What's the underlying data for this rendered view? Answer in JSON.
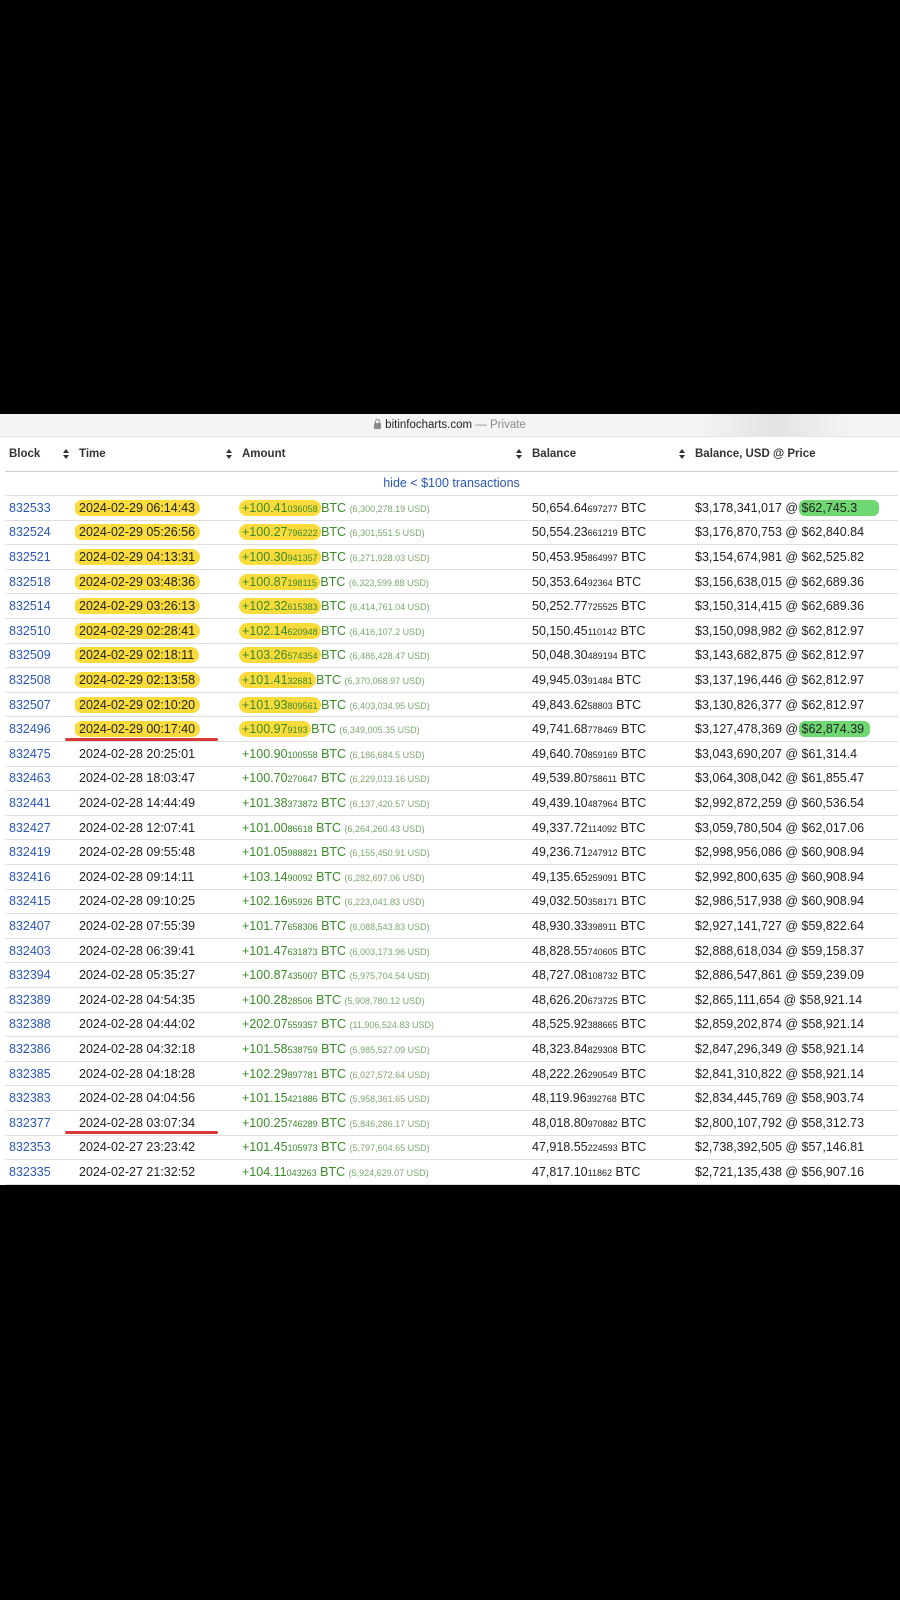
{
  "browser": {
    "domain": "bitinfocharts.com",
    "mode": "— Private"
  },
  "table": {
    "headers": {
      "block": "Block",
      "time": "Time",
      "amount": "Amount",
      "balance": "Balance",
      "balance_usd": "Balance, USD @ Price"
    },
    "filter_link": "hide < $100 transactions",
    "rows": [
      {
        "block": "832533",
        "time": "2024-02-29 06:14:43",
        "amt_main": "+100.41",
        "amt_small": "036058",
        "amt_unit": "BTC",
        "amt_usd": "(6,300,278.19 USD)",
        "bal_main": "50,654.64",
        "bal_small": "697277",
        "bal_unit": "BTC",
        "usd": "$3,178,341,017 @ $62,745.3"
      },
      {
        "block": "832524",
        "time": "2024-02-29 05:26:56",
        "amt_main": "+100.27",
        "amt_small": "796222",
        "amt_unit": "BTC",
        "amt_usd": "(6,301,551.5 USD)",
        "bal_main": "50,554.23",
        "bal_small": "661219",
        "bal_unit": "BTC",
        "usd": "$3,176,870,753 @ $62,840.84"
      },
      {
        "block": "832521",
        "time": "2024-02-29 04:13:31",
        "amt_main": "+100.30",
        "amt_small": "941357",
        "amt_unit": "BTC",
        "amt_usd": "(6,271,928.03 USD)",
        "bal_main": "50,453.95",
        "bal_small": "864997",
        "bal_unit": "BTC",
        "usd": "$3,154,674,981 @ $62,525.82"
      },
      {
        "block": "832518",
        "time": "2024-02-29 03:48:36",
        "amt_main": "+100.87",
        "amt_small": "198115",
        "amt_unit": "BTC",
        "amt_usd": "(6,323,599.88 USD)",
        "bal_main": "50,353.64",
        "bal_small": "92364",
        "bal_unit": "BTC",
        "usd": "$3,156,638,015 @ $62,689.36"
      },
      {
        "block": "832514",
        "time": "2024-02-29 03:26:13",
        "amt_main": "+102.32",
        "amt_small": "615383",
        "amt_unit": "BTC",
        "amt_usd": "(6,414,761.04 USD)",
        "bal_main": "50,252.77",
        "bal_small": "725525",
        "bal_unit": "BTC",
        "usd": "$3,150,314,415 @ $62,689.36"
      },
      {
        "block": "832510",
        "time": "2024-02-29 02:28:41",
        "amt_main": "+102.14",
        "amt_small": "620948",
        "amt_unit": "BTC",
        "amt_usd": "(6,416,107.2 USD)",
        "bal_main": "50,150.45",
        "bal_small": "110142",
        "bal_unit": "BTC",
        "usd": "$3,150,098,982 @ $62,812.97"
      },
      {
        "block": "832509",
        "time": "2024-02-29 02:18:11",
        "amt_main": "+103.26",
        "amt_small": "574354",
        "amt_unit": "BTC",
        "amt_usd": "(6,486,428.47 USD)",
        "bal_main": "50,048.30",
        "bal_small": "489194",
        "bal_unit": "BTC",
        "usd": "$3,143,682,875 @ $62,812.97"
      },
      {
        "block": "832508",
        "time": "2024-02-29 02:13:58",
        "amt_main": "+101.41",
        "amt_small": "32681",
        "amt_unit": "BTC",
        "amt_usd": "(6,370,068.97 USD)",
        "bal_main": "49,945.03",
        "bal_small": "91484",
        "bal_unit": "BTC",
        "usd": "$3,137,196,446 @ $62,812.97"
      },
      {
        "block": "832507",
        "time": "2024-02-29 02:10:20",
        "amt_main": "+101.93",
        "amt_small": "809561",
        "amt_unit": "BTC",
        "amt_usd": "(6,403,034.95 USD)",
        "bal_main": "49,843.62",
        "bal_small": "58803",
        "bal_unit": "BTC",
        "usd": "$3,130,826,377 @ $62,812.97"
      },
      {
        "block": "832496",
        "time": "2024-02-29 00:17:40",
        "amt_main": "+100.97",
        "amt_small": "9193",
        "amt_unit": "BTC",
        "amt_usd": "(6,349,005.35 USD)",
        "bal_main": "49,741.68",
        "bal_small": "778469",
        "bal_unit": "BTC",
        "usd": "$3,127,478,369 @ $62,874.39"
      },
      {
        "block": "832475",
        "time": "2024-02-28 20:25:01",
        "amt_main": "+100.90",
        "amt_small": "100558",
        "amt_unit": "BTC",
        "amt_usd": "(6,186,684.5 USD)",
        "bal_main": "49,640.70",
        "bal_small": "859169",
        "bal_unit": "BTC",
        "usd": "$3,043,690,207 @ $61,314.4"
      },
      {
        "block": "832463",
        "time": "2024-02-28 18:03:47",
        "amt_main": "+100.70",
        "amt_small": "270647",
        "amt_unit": "BTC",
        "amt_usd": "(6,229,013.16 USD)",
        "bal_main": "49,539.80",
        "bal_small": "758611",
        "bal_unit": "BTC",
        "usd": "$3,064,308,042 @ $61,855.47"
      },
      {
        "block": "832441",
        "time": "2024-02-28 14:44:49",
        "amt_main": "+101.38",
        "amt_small": "373872",
        "amt_unit": "BTC",
        "amt_usd": "(6,137,420.57 USD)",
        "bal_main": "49,439.10",
        "bal_small": "487964",
        "bal_unit": "BTC",
        "usd": "$2,992,872,259 @ $60,536.54"
      },
      {
        "block": "832427",
        "time": "2024-02-28 12:07:41",
        "amt_main": "+101.00",
        "amt_small": "86618",
        "amt_unit": "BTC",
        "amt_usd": "(6,264,260.43 USD)",
        "bal_main": "49,337.72",
        "bal_small": "114092",
        "bal_unit": "BTC",
        "usd": "$3,059,780,504 @ $62,017.06"
      },
      {
        "block": "832419",
        "time": "2024-02-28 09:55:48",
        "amt_main": "+101.05",
        "amt_small": "988821",
        "amt_unit": "BTC",
        "amt_usd": "(6,155,450.91 USD)",
        "bal_main": "49,236.71",
        "bal_small": "247912",
        "bal_unit": "BTC",
        "usd": "$2,998,956,086 @ $60,908.94"
      },
      {
        "block": "832416",
        "time": "2024-02-28 09:14:11",
        "amt_main": "+103.14",
        "amt_small": "90092",
        "amt_unit": "BTC",
        "amt_usd": "(6,282,697.06 USD)",
        "bal_main": "49,135.65",
        "bal_small": "259091",
        "bal_unit": "BTC",
        "usd": "$2,992,800,635 @ $60,908.94"
      },
      {
        "block": "832415",
        "time": "2024-02-28 09:10:25",
        "amt_main": "+102.16",
        "amt_small": "95926",
        "amt_unit": "BTC",
        "amt_usd": "(6,223,041.83 USD)",
        "bal_main": "49,032.50",
        "bal_small": "358171",
        "bal_unit": "BTC",
        "usd": "$2,986,517,938 @ $60,908.94"
      },
      {
        "block": "832407",
        "time": "2024-02-28 07:55:39",
        "amt_main": "+101.77",
        "amt_small": "658306",
        "amt_unit": "BTC",
        "amt_usd": "(6,088,543.83 USD)",
        "bal_main": "48,930.33",
        "bal_small": "398911",
        "bal_unit": "BTC",
        "usd": "$2,927,141,727 @ $59,822.64"
      },
      {
        "block": "832403",
        "time": "2024-02-28 06:39:41",
        "amt_main": "+101.47",
        "amt_small": "631873",
        "amt_unit": "BTC",
        "amt_usd": "(6,003,173.96 USD)",
        "bal_main": "48,828.55",
        "bal_small": "740605",
        "bal_unit": "BTC",
        "usd": "$2,888,618,034 @ $59,158.37"
      },
      {
        "block": "832394",
        "time": "2024-02-28 05:35:27",
        "amt_main": "+100.87",
        "amt_small": "435007",
        "amt_unit": "BTC",
        "amt_usd": "(5,975,704.54 USD)",
        "bal_main": "48,727.08",
        "bal_small": "108732",
        "bal_unit": "BTC",
        "usd": "$2,886,547,861 @ $59,239.09"
      },
      {
        "block": "832389",
        "time": "2024-02-28 04:54:35",
        "amt_main": "+100.28",
        "amt_small": "28506",
        "amt_unit": "BTC",
        "amt_usd": "(5,908,780.12 USD)",
        "bal_main": "48,626.20",
        "bal_small": "673725",
        "bal_unit": "BTC",
        "usd": "$2,865,111,654 @ $58,921.14"
      },
      {
        "block": "832388",
        "time": "2024-02-28 04:44:02",
        "amt_main": "+202.07",
        "amt_small": "559357",
        "amt_unit": "BTC",
        "amt_usd": "(11,906,524.83 USD)",
        "bal_main": "48,525.92",
        "bal_small": "388665",
        "bal_unit": "BTC",
        "usd": "$2,859,202,874 @ $58,921.14"
      },
      {
        "block": "832386",
        "time": "2024-02-28 04:32:18",
        "amt_main": "+101.58",
        "amt_small": "538759",
        "amt_unit": "BTC",
        "amt_usd": "(5,985,527.09 USD)",
        "bal_main": "48,323.84",
        "bal_small": "829308",
        "bal_unit": "BTC",
        "usd": "$2,847,296,349 @ $58,921.14"
      },
      {
        "block": "832385",
        "time": "2024-02-28 04:18:28",
        "amt_main": "+102.29",
        "amt_small": "897781",
        "amt_unit": "BTC",
        "amt_usd": "(6,027,572.64 USD)",
        "bal_main": "48,222.26",
        "bal_small": "290549",
        "bal_unit": "BTC",
        "usd": "$2,841,310,822 @ $58,921.14"
      },
      {
        "block": "832383",
        "time": "2024-02-28 04:04:56",
        "amt_main": "+101.15",
        "amt_small": "421886",
        "amt_unit": "BTC",
        "amt_usd": "(5,958,361.65 USD)",
        "bal_main": "48,119.96",
        "bal_small": "392768",
        "bal_unit": "BTC",
        "usd": "$2,834,445,769 @ $58,903.74"
      },
      {
        "block": "832377",
        "time": "2024-02-28 03:07:34",
        "amt_main": "+100.25",
        "amt_small": "746289",
        "amt_unit": "BTC",
        "amt_usd": "(5,846,286.17 USD)",
        "bal_main": "48,018.80",
        "bal_small": "970882",
        "bal_unit": "BTC",
        "usd": "$2,800,107,792 @ $58,312.73"
      },
      {
        "block": "832353",
        "time": "2024-02-27 23:23:42",
        "amt_main": "+101.45",
        "amt_small": "105973",
        "amt_unit": "BTC",
        "amt_usd": "(5,797,604.65 USD)",
        "bal_main": "47,918.55",
        "bal_small": "224593",
        "bal_unit": "BTC",
        "usd": "$2,738,392,505 @ $57,146.81"
      },
      {
        "block": "832335",
        "time": "2024-02-27 21:32:52",
        "amt_main": "+104.11",
        "amt_small": "043263",
        "amt_unit": "BTC",
        "amt_usd": "(5,924,629.07 USD)",
        "bal_main": "47,817.10",
        "bal_small": "11862",
        "bal_unit": "BTC",
        "usd": "$2,721,135,438 @ $56,907.16"
      }
    ]
  },
  "highlights": {
    "yellow_rows": 10,
    "yellow_color": "#f9dc3c",
    "green_color": "#6fd772",
    "green_rows": [
      0,
      9
    ],
    "red_underline_rows": [
      9,
      25
    ],
    "red_color": "#d63a38"
  }
}
